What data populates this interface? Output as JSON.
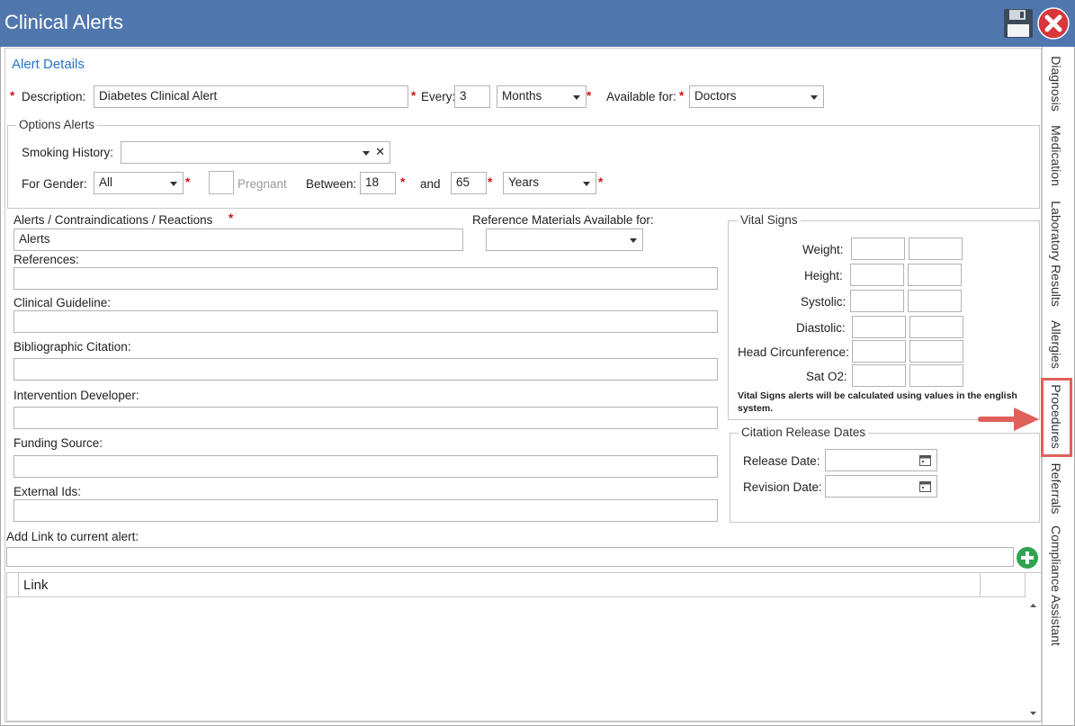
{
  "window": {
    "title": "Clinical Alerts"
  },
  "alert_details": {
    "section_title": "Alert Details",
    "description_label": "Description:",
    "description_value": "Diabetes Clinical Alert",
    "every_label": "Every:",
    "every_value": "3",
    "every_unit": "Months",
    "available_for_label": "Available for:",
    "available_for_value": "Doctors"
  },
  "options_alerts": {
    "legend": "Options Alerts",
    "smoking_label": "Smoking History:",
    "smoking_clear": "✕",
    "gender_label": "For Gender:",
    "gender_value": "All",
    "pregnant_label": "Pregnant",
    "between_label": "Between:",
    "age_from": "18",
    "and_label": "and",
    "age_to": "65",
    "age_unit": "Years"
  },
  "left_fields": {
    "alerts_label": "Alerts / Contraindications / Reactions",
    "alerts_value": "Alerts",
    "ref_materials_label": "Reference Materials Available for:",
    "references_label": "References:",
    "clinical_guideline_label": "Clinical Guideline:",
    "bibliographic_label": "Bibliographic Citation:",
    "intervention_label": "Intervention Developer:",
    "funding_label": "Funding Source:",
    "external_ids_label": "External Ids:"
  },
  "vital_signs": {
    "legend": "Vital Signs",
    "rows": [
      {
        "label": "Weight:"
      },
      {
        "label": "Height:"
      },
      {
        "label": "Systolic:"
      },
      {
        "label": "Diastolic:"
      },
      {
        "label": "Head Circunference:"
      },
      {
        "label": "Sat O2:"
      }
    ],
    "note": "Vital Signs alerts will be calculated using values in the english system."
  },
  "citation_dates": {
    "legend": "Citation Release Dates",
    "release_label": "Release Date:",
    "revision_label": "Revision Date:"
  },
  "links": {
    "add_label": "Add Link to current alert:",
    "column_header": "Link"
  },
  "side_tabs": [
    "Diagnosis",
    "Medication",
    "Laboratory Results",
    "Allergies",
    "Procedures",
    "Referrals",
    "Compliance Assistant"
  ],
  "colors": {
    "titlebar": "#5077ad",
    "accent": "#2a74c4",
    "required": "#d21414",
    "highlight": "#e0605a",
    "add_green": "#2ea44f"
  }
}
